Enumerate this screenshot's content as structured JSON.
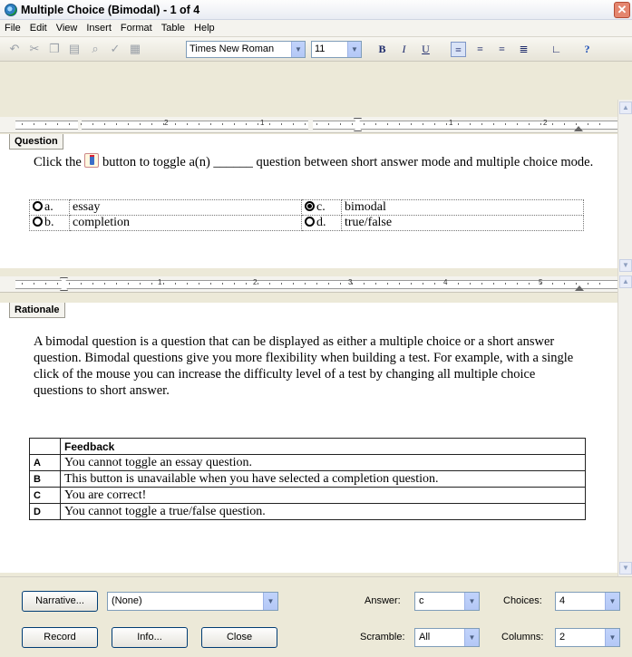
{
  "window": {
    "title": "Multiple Choice (Bimodal) - 1 of 4",
    "close_glyph": "✕"
  },
  "menu": [
    "File",
    "Edit",
    "View",
    "Insert",
    "Format",
    "Table",
    "Help"
  ],
  "toolbar": {
    "font_name": "Times New Roman",
    "font_size": "11",
    "bold": "B",
    "italic": "I",
    "underline": "U",
    "help": "?"
  },
  "question": {
    "tab_label": "Question",
    "text_before": "Click the",
    "text_after": "button to toggle a(n) ______ question between short answer mode and multiple choice mode.",
    "selected_choice": "c",
    "choices": [
      {
        "letter": "a.",
        "text": "essay",
        "selected": false
      },
      {
        "letter": "b.",
        "text": "completion",
        "selected": false
      },
      {
        "letter": "c.",
        "text": "bimodal",
        "selected": true
      },
      {
        "letter": "d.",
        "text": "true/false",
        "selected": false
      }
    ]
  },
  "ruler_top": {
    "numbers": [
      "2",
      "1",
      "1",
      "2"
    ]
  },
  "ruler_bottom": {
    "numbers": [
      "1",
      "2",
      "3",
      "4",
      "5"
    ]
  },
  "rationale": {
    "tab_label": "Rationale",
    "text": "A bimodal question is a question that can be displayed as either a multiple choice or a short answer question. Bimodal questions give you more flexibility when building a test. For example, with a single click of the mouse you can increase the difficulty level of a test by changing all multiple choice questions to short answer.",
    "feedback_header": "Feedback",
    "feedback": [
      {
        "letter": "A",
        "text": "You cannot toggle an essay question."
      },
      {
        "letter": "B",
        "text": "This button is unavailable when you have selected a completion question."
      },
      {
        "letter": "C",
        "text": "You are correct!"
      },
      {
        "letter": "D",
        "text": "You cannot toggle a true/false question."
      }
    ]
  },
  "bottom": {
    "narrative_button": "Narrative...",
    "narrative_value": "(None)",
    "answer_label": "Answer:",
    "answer_value": "c",
    "choices_label": "Choices:",
    "choices_value": "4",
    "scramble_label": "Scramble:",
    "scramble_value": "All",
    "columns_label": "Columns:",
    "columns_value": "2",
    "record_button": "Record",
    "info_button": "Info...",
    "close_button": "Close"
  }
}
